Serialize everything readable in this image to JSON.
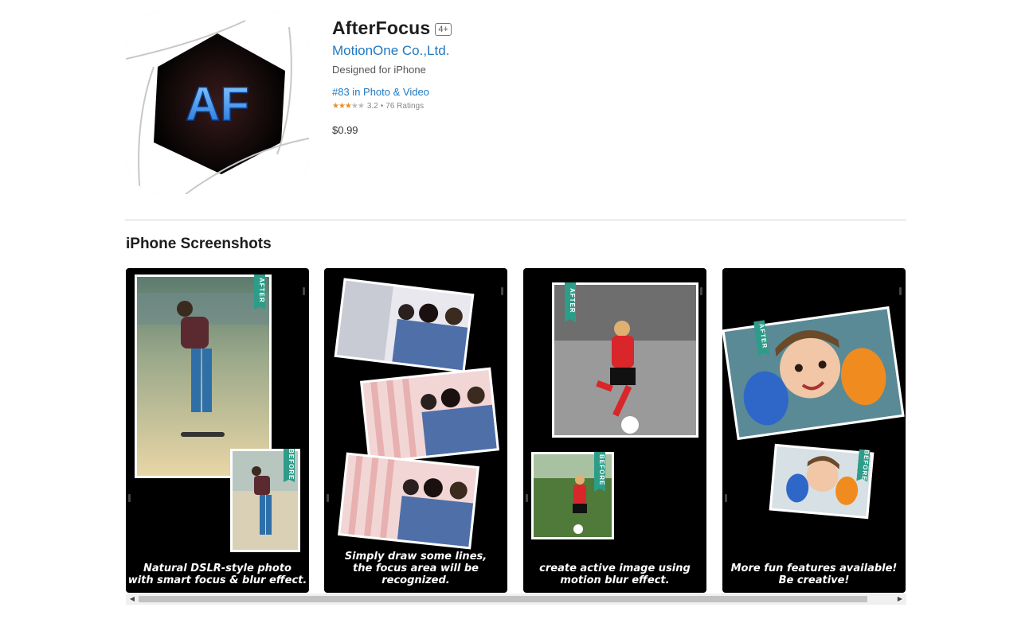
{
  "app": {
    "title": "AfterFocus",
    "age_rating": "4+",
    "developer": "MotionOne Co.,Ltd.",
    "designed_for": "Designed for iPhone",
    "ranking": "#83 in Photo & Video",
    "rating": {
      "value": "3.2",
      "count": "76 Ratings",
      "stars_filled": 3,
      "stars_total": 5,
      "star_color": "#f08c1f"
    },
    "price": "$0.99",
    "icon": {
      "text": "AF",
      "name": "afterfocus-app-icon"
    }
  },
  "section_title": "iPhone Screenshots",
  "screenshots": [
    {
      "caption_lines": [
        "Natural DSLR-style photo",
        "with smart focus & blur effect."
      ],
      "tag_after": "AFTER",
      "tag_before": "BEFORE"
    },
    {
      "caption_lines": [
        "Simply draw some lines,",
        "the focus area will be recognized."
      ]
    },
    {
      "caption_lines": [
        "create active image using",
        "motion blur effect."
      ],
      "tag_after": "AFTER",
      "tag_before": "BEFORE"
    },
    {
      "caption_lines": [
        "More fun features available!",
        "Be creative!"
      ],
      "tag_after": "AFTER",
      "tag_before": "BEFORE"
    }
  ],
  "scrollbar": {
    "left_arrow": "◀",
    "right_arrow": "▶"
  },
  "colors": {
    "link": "#1f78c1",
    "tape": "#2d9c88",
    "screenshot_bg": "#000000"
  }
}
